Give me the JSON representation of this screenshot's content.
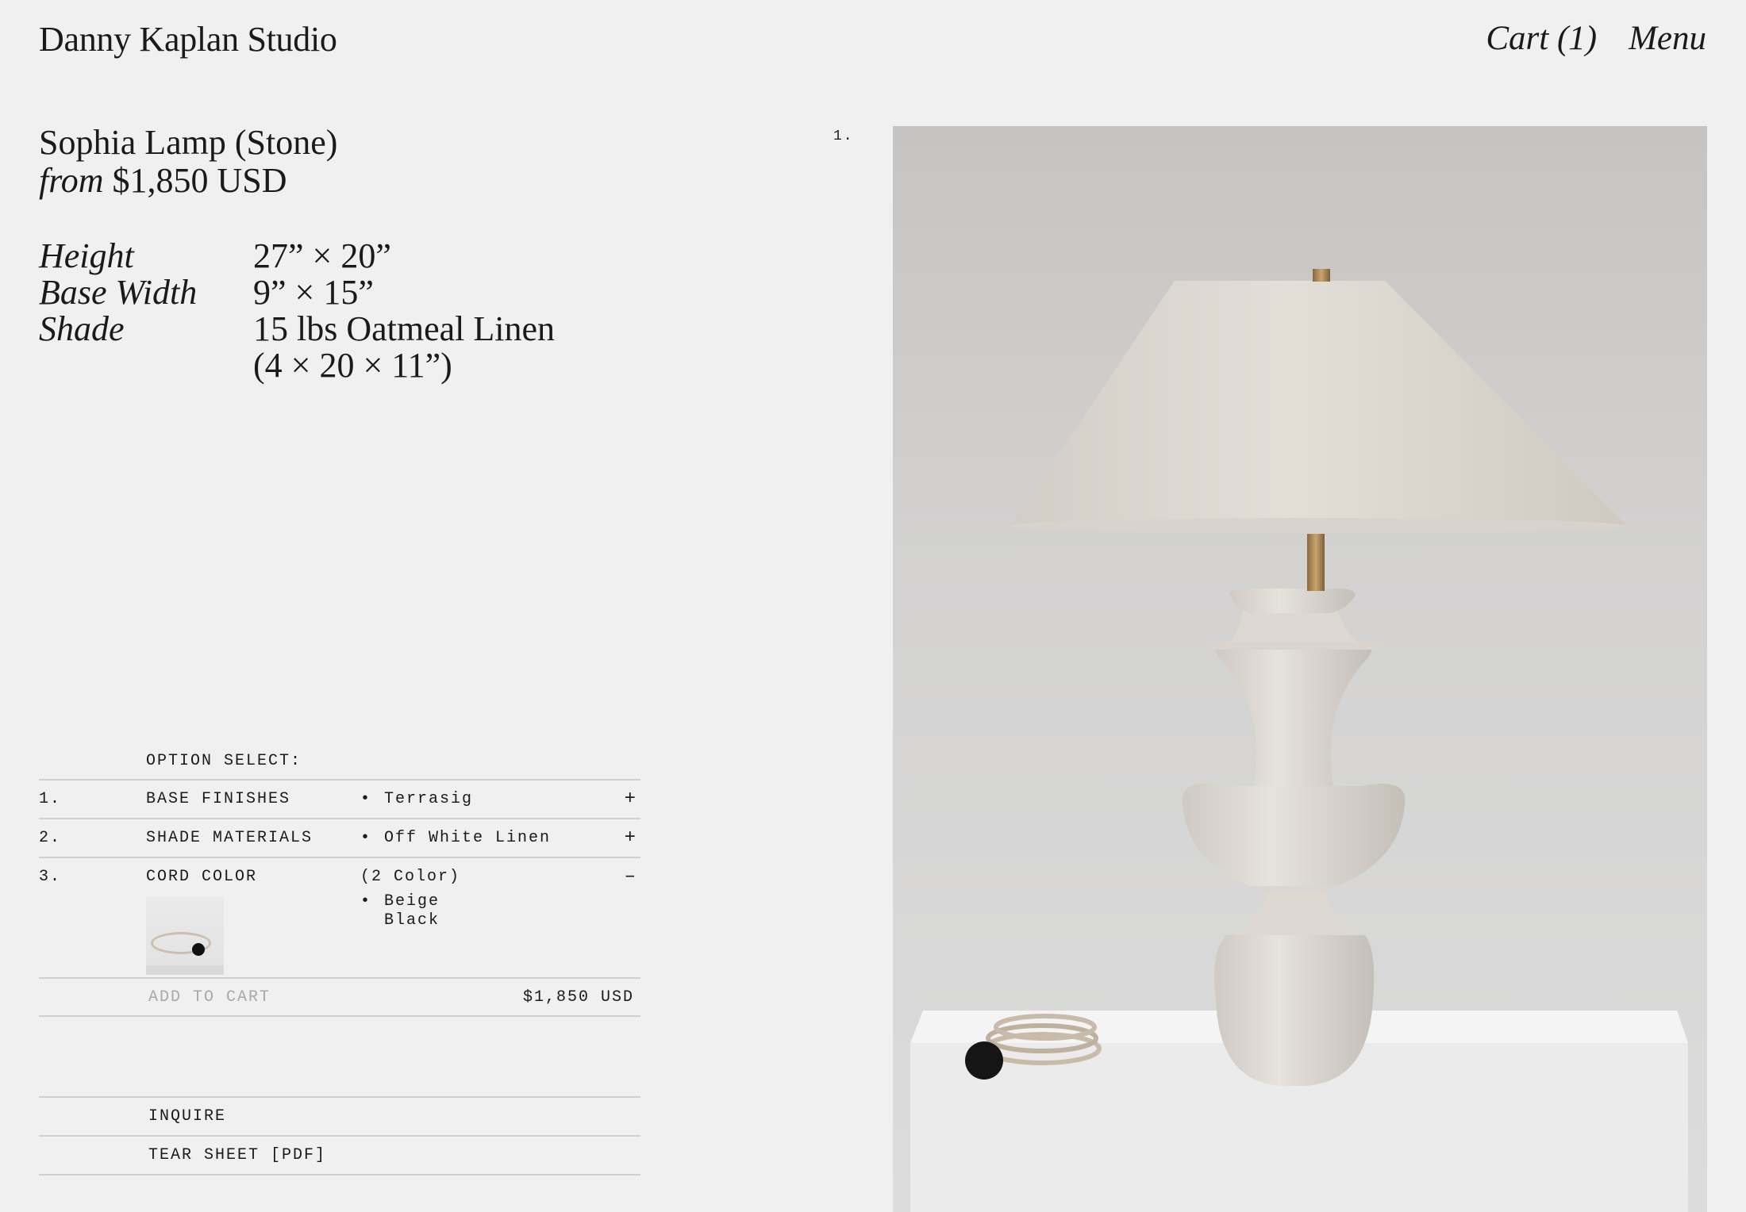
{
  "header": {
    "brand": "Danny Kaplan Studio",
    "cart": "Cart (1)",
    "menu": "Menu"
  },
  "product": {
    "name": "Sophia Lamp (Stone)",
    "price_prefix": "from",
    "price": "$1,850 USD",
    "specs": [
      {
        "label": "Height",
        "value": "27” × 20”"
      },
      {
        "label": "Base Width",
        "value": "9” × 15”"
      },
      {
        "label": "Shade",
        "value": "15 lbs Oatmeal Linen\n(4 × 20 × 11”)"
      }
    ]
  },
  "options": {
    "heading": "OPTION SELECT:",
    "items": [
      {
        "num": "1.",
        "name": "BASE FINISHES",
        "bullet": "•",
        "value": "Terrasig",
        "toggle": "+"
      },
      {
        "num": "2.",
        "name": "SHADE MATERIALS",
        "bullet": "•",
        "value": "Off White Linen",
        "toggle": "+"
      },
      {
        "num": "3.",
        "name": "CORD COLOR",
        "count": "(2 Color)",
        "bullet": "•",
        "choices": [
          "Beige",
          "Black"
        ],
        "toggle": "–"
      }
    ],
    "add_to_cart": "ADD TO CART",
    "total": "$1,850 USD"
  },
  "links": {
    "inquire": "INQUIRE",
    "tear_sheet": "TEAR SHEET [PDF]"
  },
  "gallery": {
    "index": "1."
  }
}
